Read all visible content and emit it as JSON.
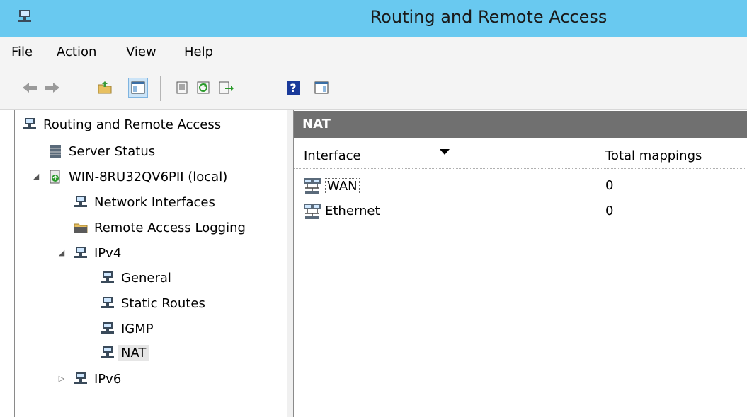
{
  "window": {
    "title": "Routing and Remote Access",
    "app_icon": "rras-icon"
  },
  "menu": {
    "items": [
      {
        "key": "F",
        "rest": "ile"
      },
      {
        "key": "A",
        "rest": "ction"
      },
      {
        "key": "V",
        "rest": "iew"
      },
      {
        "key": "H",
        "rest": "elp"
      }
    ]
  },
  "toolbar": {
    "buttons": [
      "back-arrow-icon",
      "forward-arrow-icon",
      "up-folder-icon",
      "show-hide-tree-icon",
      "properties-icon",
      "refresh-icon",
      "export-list-icon",
      "help-icon",
      "show-action-pane-icon"
    ]
  },
  "tree": {
    "root": "Routing and Remote Access",
    "server_status": "Server Status",
    "server": "WIN-8RU32QV6PII (local)",
    "network_interfaces": "Network Interfaces",
    "remote_access_logging": "Remote Access Logging",
    "ipv4": "IPv4",
    "general": "General",
    "static_routes": "Static Routes",
    "igmp": "IGMP",
    "nat": "NAT",
    "ipv6": "IPv6"
  },
  "pane": {
    "title": "NAT",
    "columns": {
      "interface": "Interface",
      "total_mappings": "Total mappings"
    },
    "rows": [
      {
        "interface": "WAN",
        "total_mappings": "0"
      },
      {
        "interface": "Ethernet",
        "total_mappings": "0"
      }
    ]
  }
}
